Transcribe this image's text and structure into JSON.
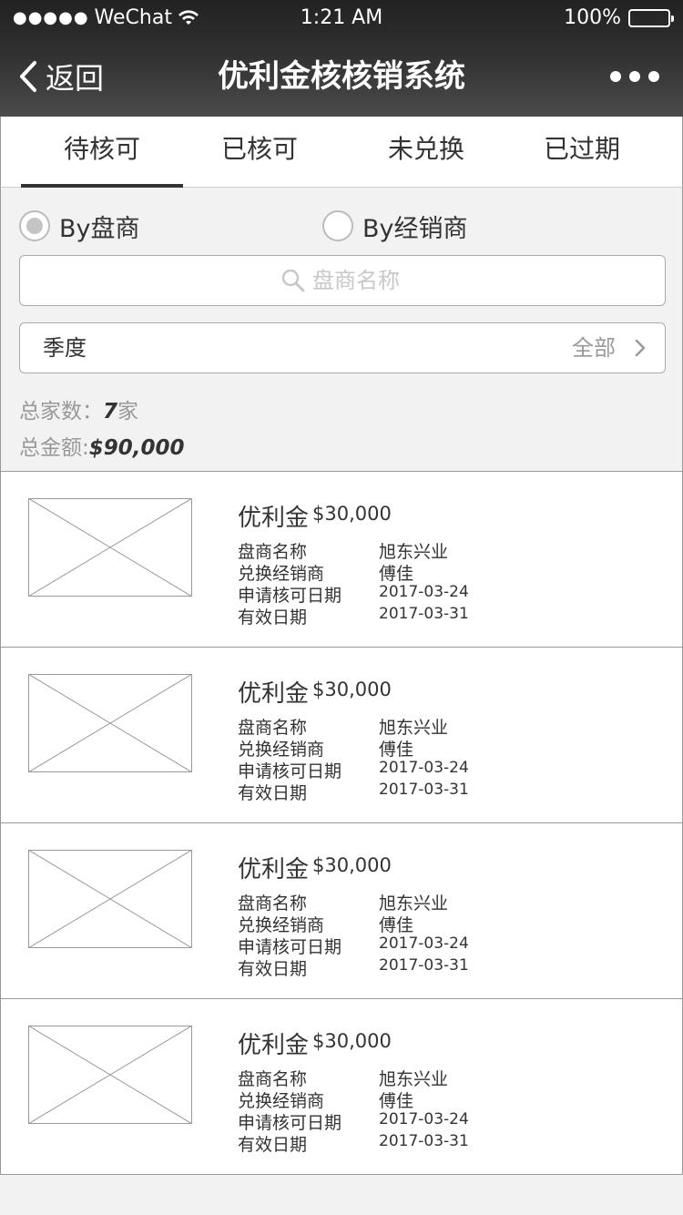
{
  "status_bar": {
    "carrier_dots": "●●●●●",
    "carrier": "WeChat",
    "time": "1:21 AM",
    "battery": "100%",
    "battery_level": 1.0
  },
  "nav": {
    "back_label": "返回",
    "title": "优利金核核销系统",
    "more_icon": "more-dots-icon"
  },
  "tabs": [
    {
      "label": "待核可",
      "active": true
    },
    {
      "label": "已核可",
      "active": false
    },
    {
      "label": "未兑换",
      "active": false
    },
    {
      "label": "已过期",
      "active": false
    }
  ],
  "filters": {
    "radio_options": [
      {
        "label": "By盘商",
        "selected": true
      },
      {
        "label": "By经销商",
        "selected": false
      }
    ],
    "search": {
      "placeholder": "盘商名称",
      "value": ""
    },
    "season": {
      "label": "季度",
      "value": "全部"
    }
  },
  "summary": {
    "total_count_label": "总家数：",
    "total_count_value": "7",
    "total_count_unit": "家",
    "total_amount_label": "总金额:",
    "total_amount_value": "$90,000"
  },
  "items": [
    {
      "title": "优利金",
      "amount": "$30,000",
      "dealer_label": "盘商名称",
      "dealer": "旭东兴业",
      "exchange_label": "兑换经销商",
      "exchange": "傅佳",
      "apply_label": "申请核可日期",
      "apply_date": "2017-03-24",
      "valid_label": "有效日期",
      "valid_date": "2017-03-31"
    },
    {
      "title": "优利金",
      "amount": "$30,000",
      "dealer_label": "盘商名称",
      "dealer": "旭东兴业",
      "exchange_label": "兑换经销商",
      "exchange": "傅佳",
      "apply_label": "申请核可日期",
      "apply_date": "2017-03-24",
      "valid_label": "有效日期",
      "valid_date": "2017-03-31"
    },
    {
      "title": "优利金",
      "amount": "$30,000",
      "dealer_label": "盘商名称",
      "dealer": "旭东兴业",
      "exchange_label": "兑换经销商",
      "exchange": "傅佳",
      "apply_label": "申请核可日期",
      "apply_date": "2017-03-24",
      "valid_label": "有效日期",
      "valid_date": "2017-03-31"
    },
    {
      "title": "优利金",
      "amount": "$30,000",
      "dealer_label": "盘商名称",
      "dealer": "旭东兴业",
      "exchange_label": "兑换经销商",
      "exchange": "傅佳",
      "apply_label": "申请核可日期",
      "apply_date": "2017-03-24",
      "valid_label": "有效日期",
      "valid_date": "2017-03-31"
    }
  ],
  "colors": {
    "nav_bg": "#2e2e2e",
    "page_bg": "#f2f2f2",
    "text": "#333333",
    "muted": "#999999",
    "placeholder": "#c8c8c8"
  }
}
